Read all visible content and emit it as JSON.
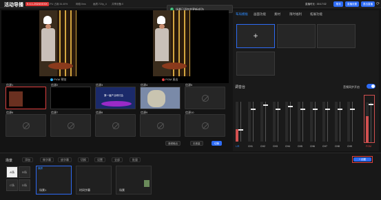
{
  "app": {
    "title": "活动导播",
    "version": "5.4.1-2024XXXX",
    "stats": [
      "CPU 占用:34.40%",
      "网络:0ms",
      "画质:720p_4",
      "共享设备:0"
    ],
    "toast": "场景已添加并更新成功!",
    "timer": "直播时长 : 00:17:02",
    "buttons": {
      "start": "推流",
      "settings": "直播设置",
      "exit": "退出直播"
    }
  },
  "preview": {
    "pvw_label": "PVW 预览",
    "pgm_label": "PGM 直出"
  },
  "sources": {
    "labels": [
      "信源1",
      "信源2",
      "信源3",
      "信源4",
      "信源5",
      "信源6",
      "信源7",
      "信源8",
      "信源9",
      "信源10"
    ],
    "slide_title": "第一届产业研讨会",
    "ctrl": {
      "audio": "音频输出",
      "layout": "无音量",
      "cut": "切换"
    }
  },
  "right": {
    "tabs": [
      "布局模板",
      "画面功能",
      "素材",
      "限时福利",
      "拓展功能"
    ],
    "active_tab": 0
  },
  "mixer": {
    "title": "调音台",
    "monitor": "音频同步开启",
    "channels": [
      "L/R",
      "CH1",
      "CH2",
      "CH3",
      "CH4",
      "CH5",
      "CH6",
      "CH7",
      "CH8",
      "CH9",
      "PGM"
    ]
  },
  "bottom": {
    "scene_title": "场景",
    "scene_labels": [
      "A场",
      "B场",
      "C场",
      "D场"
    ],
    "tools": [
      "添加",
      "做字幕",
      "放字幕",
      "切换",
      "设置",
      "全部",
      "批量"
    ],
    "cards": [
      {
        "title": "场景1",
        "sub": "横屏"
      },
      {
        "title": "时间字幕",
        "sub": ""
      },
      {
        "title": "场景",
        "sub": ""
      }
    ],
    "create_btn": "+ 创建"
  },
  "colors": {
    "accent": "#2e6cf6",
    "pvw": "#2db3ff",
    "pgm": "#e04040",
    "toast_ok": "#2db36b"
  }
}
